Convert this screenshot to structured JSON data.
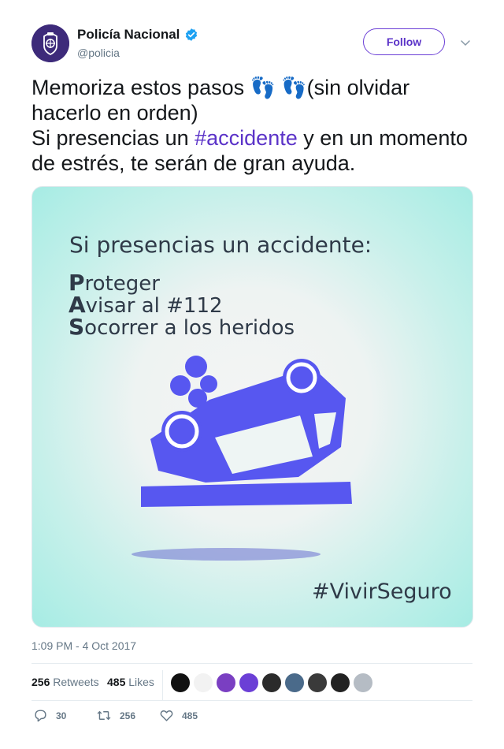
{
  "author": {
    "name": "Policía Nacional",
    "handle": "@policia",
    "verified": true,
    "follow_label": "Follow"
  },
  "tweet": {
    "line1_a": "Memoriza estos pasos ",
    "footprints_emoji": "👣 👣",
    "line1_b": "(sin olvidar hacerlo en orden)",
    "line2_a": "Si presencias un ",
    "hashtag": "#accidente",
    "line2_b": " y en un momento de estrés, te serán de gran ayuda."
  },
  "media": {
    "heading": "Si presencias un accidente:",
    "steps": [
      {
        "initial": "P",
        "rest": "roteger"
      },
      {
        "initial": "A",
        "rest": "visar al #112"
      },
      {
        "initial": "S",
        "rest": "ocorrer a los heridos"
      }
    ],
    "hashtag": "#VivirSeguro",
    "car_color": "#5757f0"
  },
  "timestamp": "1:09 PM - 4 Oct 2017",
  "stats": {
    "retweets_count": "256",
    "retweets_label": "Retweets",
    "likes_count": "485",
    "likes_label": "Likes"
  },
  "actions": {
    "replies": "30",
    "retweets": "256",
    "likes": "485"
  },
  "likers_colors": [
    "#111111",
    "#f2f2f2",
    "#7a3fc2",
    "#6b3fd6",
    "#2b2b2b",
    "#4a6a8a",
    "#3a3a3a",
    "#222222",
    "#b5bcc4"
  ],
  "colors": {
    "accent": "#5b33c8",
    "verified": "#1da1f2",
    "muted": "#657786"
  }
}
